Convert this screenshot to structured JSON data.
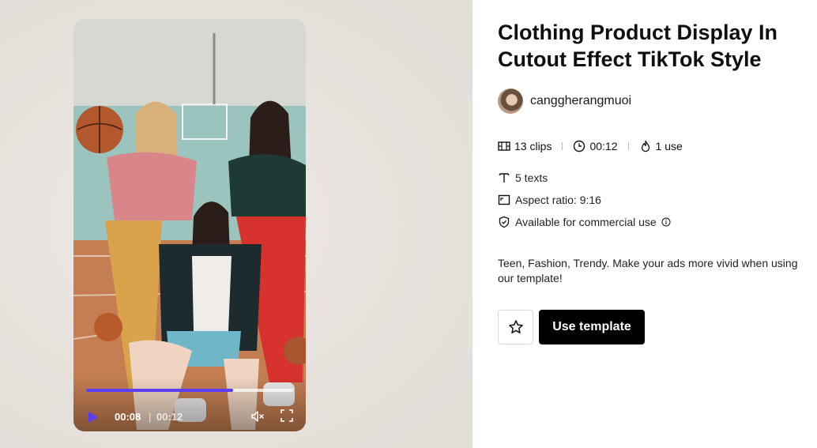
{
  "template": {
    "title": "Clothing Product Display In Cutout Effect TikTok Style",
    "author": "canggherangmuoi",
    "stats": {
      "clips": "13 clips",
      "duration": "00:12",
      "uses": "1 use"
    },
    "texts": "5 texts",
    "aspect_ratio": "Aspect ratio: 9:16",
    "license": "Available for commercial use",
    "description": "Teen, Fashion, Trendy. Make your ads more vivid when using our template!"
  },
  "player": {
    "current_time": "00:08",
    "separator": "|",
    "total_time": "00:12",
    "progress": 0.71,
    "accent": "#5b3df5"
  },
  "actions": {
    "use_template_label": "Use template",
    "favorite_icon": "star-icon"
  }
}
